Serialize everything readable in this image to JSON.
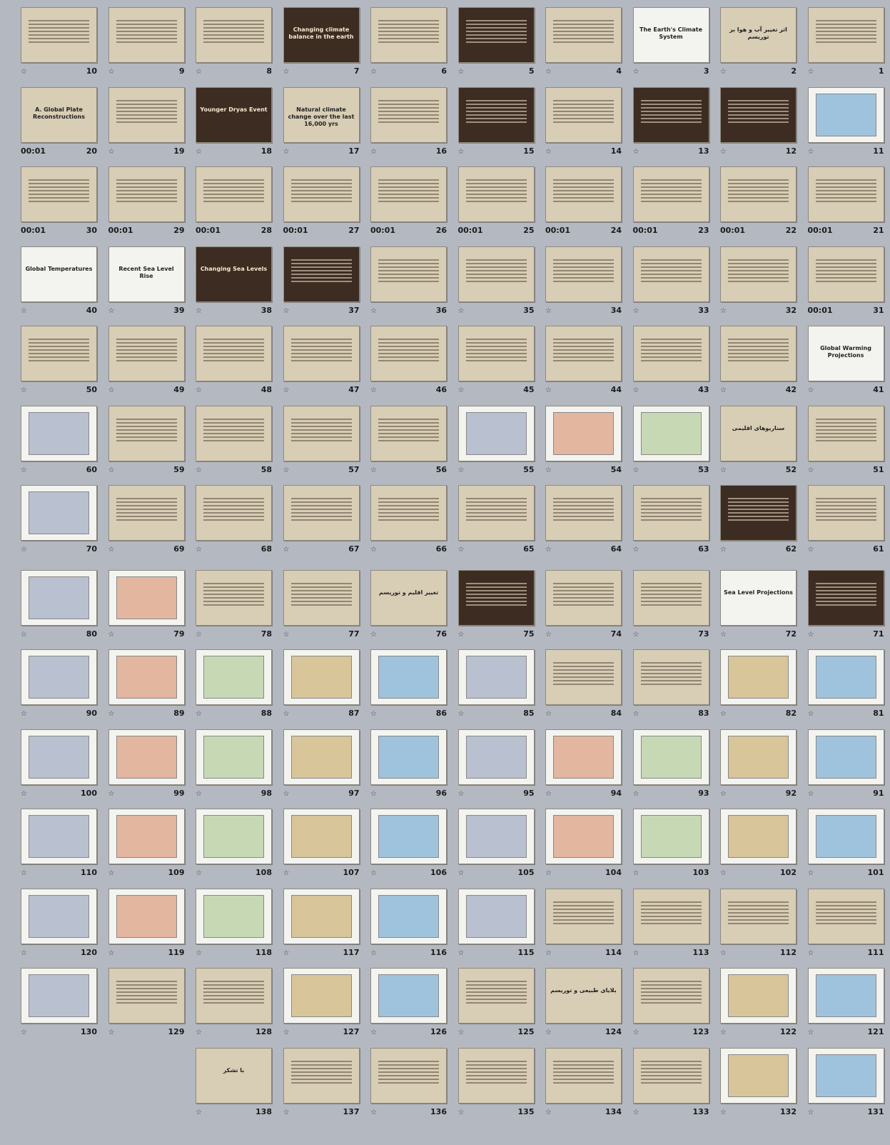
{
  "view": "slide-sorter",
  "icons": {
    "transition": "star-icon"
  },
  "slides": [
    {
      "n": "1",
      "title": "",
      "theme": "light"
    },
    {
      "n": "2",
      "title": "اثر تغییر آب و هوا بر توریسم",
      "theme": "light"
    },
    {
      "n": "3",
      "title": "The Earth's Climate System",
      "theme": "white"
    },
    {
      "n": "4",
      "title": "",
      "theme": "light"
    },
    {
      "n": "5",
      "title": "",
      "theme": "dark"
    },
    {
      "n": "6",
      "title": "",
      "theme": "light"
    },
    {
      "n": "7",
      "title": "Changing climate balance in the earth",
      "theme": "dark"
    },
    {
      "n": "8",
      "title": "",
      "theme": "light"
    },
    {
      "n": "9",
      "title": "",
      "theme": "light"
    },
    {
      "n": "10",
      "title": "",
      "theme": "light"
    },
    {
      "n": "11",
      "title": "",
      "theme": "white"
    },
    {
      "n": "12",
      "title": "",
      "theme": "dark"
    },
    {
      "n": "13",
      "title": "",
      "theme": "dark"
    },
    {
      "n": "14",
      "title": "",
      "theme": "light"
    },
    {
      "n": "15",
      "title": "",
      "theme": "dark"
    },
    {
      "n": "16",
      "title": "",
      "theme": "light"
    },
    {
      "n": "17",
      "title": "Natural climate change over the last 16,000 yrs",
      "theme": "light"
    },
    {
      "n": "18",
      "title": "Younger Dryas Event",
      "theme": "dark"
    },
    {
      "n": "19",
      "title": "",
      "theme": "light"
    },
    {
      "n": "20",
      "title": "A. Global Plate Reconstructions",
      "theme": "light",
      "time": "00:01"
    },
    {
      "n": "21",
      "title": "",
      "theme": "light",
      "time": "00:01"
    },
    {
      "n": "22",
      "title": "",
      "theme": "light",
      "time": "00:01"
    },
    {
      "n": "23",
      "title": "",
      "theme": "light",
      "time": "00:01"
    },
    {
      "n": "24",
      "title": "",
      "theme": "light",
      "time": "00:01"
    },
    {
      "n": "25",
      "title": "",
      "theme": "light",
      "time": "00:01"
    },
    {
      "n": "26",
      "title": "",
      "theme": "light",
      "time": "00:01"
    },
    {
      "n": "27",
      "title": "",
      "theme": "light",
      "time": "00:01"
    },
    {
      "n": "28",
      "title": "",
      "theme": "light",
      "time": "00:01"
    },
    {
      "n": "29",
      "title": "",
      "theme": "light",
      "time": "00:01"
    },
    {
      "n": "30",
      "title": "",
      "theme": "light",
      "time": "00:01"
    },
    {
      "n": "31",
      "title": "",
      "theme": "light",
      "time": "00:01"
    },
    {
      "n": "32",
      "title": "",
      "theme": "light"
    },
    {
      "n": "33",
      "title": "",
      "theme": "light"
    },
    {
      "n": "34",
      "title": "",
      "theme": "light"
    },
    {
      "n": "35",
      "title": "",
      "theme": "light"
    },
    {
      "n": "36",
      "title": "",
      "theme": "light"
    },
    {
      "n": "37",
      "title": "",
      "theme": "dark"
    },
    {
      "n": "38",
      "title": "Changing Sea Levels",
      "theme": "dark"
    },
    {
      "n": "39",
      "title": "Recent Sea Level Rise",
      "theme": "white"
    },
    {
      "n": "40",
      "title": "Global Temperatures",
      "theme": "white"
    },
    {
      "n": "41",
      "title": "Global Warming Projections",
      "theme": "white"
    },
    {
      "n": "42",
      "title": "",
      "theme": "light"
    },
    {
      "n": "43",
      "title": "",
      "theme": "light"
    },
    {
      "n": "44",
      "title": "",
      "theme": "light"
    },
    {
      "n": "45",
      "title": "",
      "theme": "light"
    },
    {
      "n": "46",
      "title": "",
      "theme": "light"
    },
    {
      "n": "47",
      "title": "",
      "theme": "light"
    },
    {
      "n": "48",
      "title": "",
      "theme": "light"
    },
    {
      "n": "49",
      "title": "",
      "theme": "light"
    },
    {
      "n": "50",
      "title": "",
      "theme": "light"
    },
    {
      "n": "51",
      "title": "",
      "theme": "light"
    },
    {
      "n": "52",
      "title": "سناریوهای اقلیمی",
      "theme": "light"
    },
    {
      "n": "53",
      "title": "",
      "theme": "white"
    },
    {
      "n": "54",
      "title": "",
      "theme": "white"
    },
    {
      "n": "55",
      "title": "",
      "theme": "white"
    },
    {
      "n": "56",
      "title": "",
      "theme": "light"
    },
    {
      "n": "57",
      "title": "",
      "theme": "light"
    },
    {
      "n": "58",
      "title": "",
      "theme": "light"
    },
    {
      "n": "59",
      "title": "",
      "theme": "light"
    },
    {
      "n": "60",
      "title": "",
      "theme": "white"
    },
    {
      "n": "61",
      "title": "",
      "theme": "light"
    },
    {
      "n": "62",
      "title": "",
      "theme": "dark"
    },
    {
      "n": "63",
      "title": "",
      "theme": "light"
    },
    {
      "n": "64",
      "title": "",
      "theme": "light"
    },
    {
      "n": "65",
      "title": "",
      "theme": "light"
    },
    {
      "n": "66",
      "title": "",
      "theme": "light"
    },
    {
      "n": "67",
      "title": "",
      "theme": "light"
    },
    {
      "n": "68",
      "title": "",
      "theme": "light"
    },
    {
      "n": "69",
      "title": "",
      "theme": "light"
    },
    {
      "n": "70",
      "title": "",
      "theme": "white"
    },
    {
      "n": "71",
      "title": "",
      "theme": "dark"
    },
    {
      "n": "72",
      "title": "Sea Level Projections",
      "theme": "white"
    },
    {
      "n": "73",
      "title": "",
      "theme": "light"
    },
    {
      "n": "74",
      "title": "",
      "theme": "light"
    },
    {
      "n": "75",
      "title": "",
      "theme": "dark"
    },
    {
      "n": "76",
      "title": "تغییر اقلیم و توریسم",
      "theme": "light"
    },
    {
      "n": "77",
      "title": "",
      "theme": "light"
    },
    {
      "n": "78",
      "title": "",
      "theme": "light"
    },
    {
      "n": "79",
      "title": "",
      "theme": "white"
    },
    {
      "n": "80",
      "title": "",
      "theme": "white"
    },
    {
      "n": "81",
      "title": "",
      "theme": "white"
    },
    {
      "n": "82",
      "title": "",
      "theme": "white"
    },
    {
      "n": "83",
      "title": "",
      "theme": "light"
    },
    {
      "n": "84",
      "title": "",
      "theme": "light"
    },
    {
      "n": "85",
      "title": "",
      "theme": "white"
    },
    {
      "n": "86",
      "title": "",
      "theme": "white"
    },
    {
      "n": "87",
      "title": "",
      "theme": "white"
    },
    {
      "n": "88",
      "title": "",
      "theme": "white"
    },
    {
      "n": "89",
      "title": "",
      "theme": "white"
    },
    {
      "n": "90",
      "title": "",
      "theme": "white"
    },
    {
      "n": "91",
      "title": "",
      "theme": "white"
    },
    {
      "n": "92",
      "title": "",
      "theme": "white"
    },
    {
      "n": "93",
      "title": "",
      "theme": "white"
    },
    {
      "n": "94",
      "title": "",
      "theme": "white"
    },
    {
      "n": "95",
      "title": "",
      "theme": "white"
    },
    {
      "n": "96",
      "title": "",
      "theme": "white"
    },
    {
      "n": "97",
      "title": "",
      "theme": "white"
    },
    {
      "n": "98",
      "title": "",
      "theme": "white"
    },
    {
      "n": "99",
      "title": "",
      "theme": "white"
    },
    {
      "n": "100",
      "title": "",
      "theme": "white"
    },
    {
      "n": "101",
      "title": "",
      "theme": "white"
    },
    {
      "n": "102",
      "title": "",
      "theme": "white"
    },
    {
      "n": "103",
      "title": "",
      "theme": "white"
    },
    {
      "n": "104",
      "title": "",
      "theme": "white"
    },
    {
      "n": "105",
      "title": "",
      "theme": "white"
    },
    {
      "n": "106",
      "title": "",
      "theme": "white"
    },
    {
      "n": "107",
      "title": "",
      "theme": "white"
    },
    {
      "n": "108",
      "title": "",
      "theme": "white"
    },
    {
      "n": "109",
      "title": "",
      "theme": "white"
    },
    {
      "n": "110",
      "title": "",
      "theme": "white"
    },
    {
      "n": "111",
      "title": "",
      "theme": "light"
    },
    {
      "n": "112",
      "title": "",
      "theme": "light"
    },
    {
      "n": "113",
      "title": "",
      "theme": "light"
    },
    {
      "n": "114",
      "title": "",
      "theme": "light"
    },
    {
      "n": "115",
      "title": "",
      "theme": "white"
    },
    {
      "n": "116",
      "title": "",
      "theme": "white"
    },
    {
      "n": "117",
      "title": "",
      "theme": "white"
    },
    {
      "n": "118",
      "title": "",
      "theme": "white"
    },
    {
      "n": "119",
      "title": "",
      "theme": "white"
    },
    {
      "n": "120",
      "title": "",
      "theme": "white"
    },
    {
      "n": "121",
      "title": "",
      "theme": "white"
    },
    {
      "n": "122",
      "title": "",
      "theme": "white"
    },
    {
      "n": "123",
      "title": "",
      "theme": "light"
    },
    {
      "n": "124",
      "title": "بلایای طبیعی و توریسم",
      "theme": "light"
    },
    {
      "n": "125",
      "title": "",
      "theme": "light"
    },
    {
      "n": "126",
      "title": "",
      "theme": "white"
    },
    {
      "n": "127",
      "title": "",
      "theme": "white"
    },
    {
      "n": "128",
      "title": "",
      "theme": "light"
    },
    {
      "n": "129",
      "title": "",
      "theme": "light"
    },
    {
      "n": "130",
      "title": "",
      "theme": "white"
    },
    {
      "n": "131",
      "title": "",
      "theme": "white"
    },
    {
      "n": "132",
      "title": "",
      "theme": "white"
    },
    {
      "n": "133",
      "title": "",
      "theme": "light"
    },
    {
      "n": "134",
      "title": "",
      "theme": "light"
    },
    {
      "n": "135",
      "title": "",
      "theme": "light"
    },
    {
      "n": "136",
      "title": "",
      "theme": "light"
    },
    {
      "n": "137",
      "title": "",
      "theme": "light"
    },
    {
      "n": "138",
      "title": "با تشکر",
      "theme": "light"
    }
  ]
}
